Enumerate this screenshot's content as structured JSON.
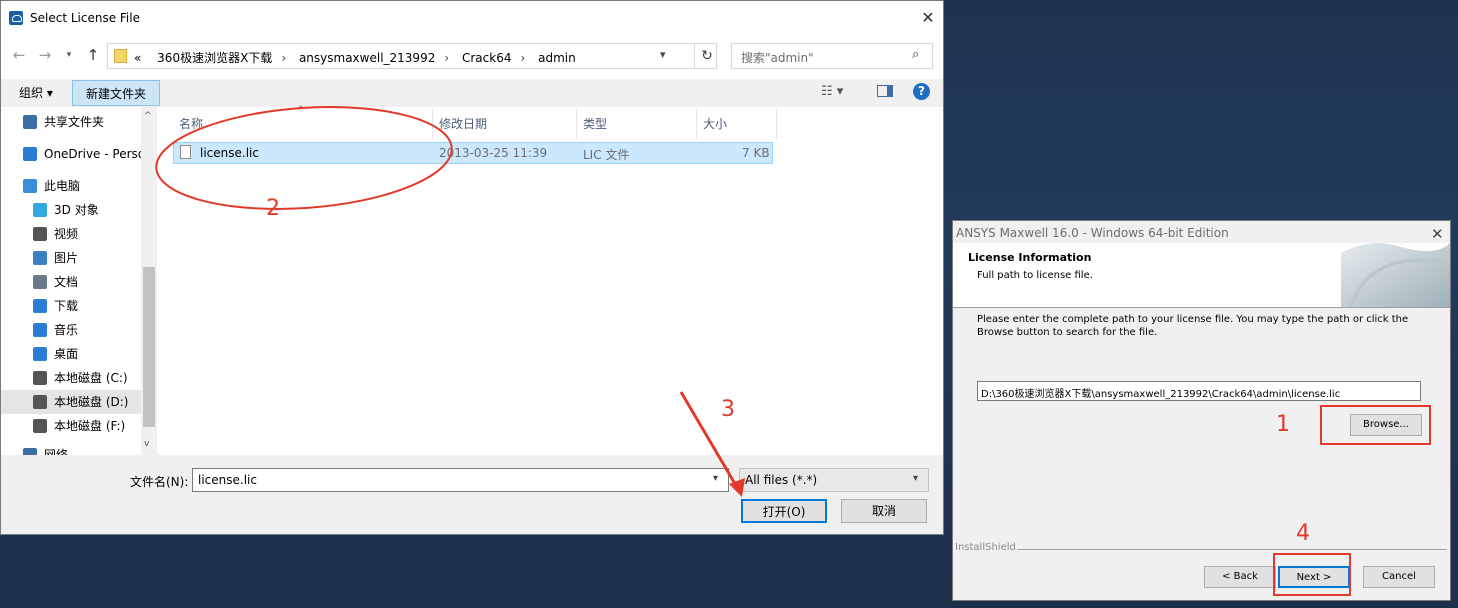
{
  "file_dialog": {
    "title": "Select License File",
    "close": "✕",
    "breadcrumb": {
      "prefix": "«",
      "items": [
        "360极速浏览器X下载",
        "ansysmaxwell_213992",
        "Crack64",
        "admin"
      ],
      "separator": "›"
    },
    "search_placeholder": "搜索\"admin\"",
    "toolbar": {
      "organize": "组织 ▾",
      "new_folder": "新建文件夹"
    },
    "sidebar": [
      {
        "label": "共享文件夹",
        "icon": "network-share-icon",
        "color": "#3c6ea3"
      },
      {
        "label": "OneDrive - Perso",
        "icon": "cloud-icon",
        "color": "#2b7cd3"
      },
      {
        "label": "此电脑",
        "icon": "computer-icon",
        "color": "#3a8ed9"
      },
      {
        "label": "3D 对象",
        "icon": "cube-icon",
        "color": "#31a8e0"
      },
      {
        "label": "视频",
        "icon": "video-icon",
        "color": "#555555"
      },
      {
        "label": "图片",
        "icon": "picture-icon",
        "color": "#3a7fc2"
      },
      {
        "label": "文档",
        "icon": "document-icon",
        "color": "#6b7a8a"
      },
      {
        "label": "下载",
        "icon": "download-icon",
        "color": "#2b7cd3"
      },
      {
        "label": "音乐",
        "icon": "music-icon",
        "color": "#2b7cd3"
      },
      {
        "label": "桌面",
        "icon": "desktop-icon",
        "color": "#2b7cd3"
      },
      {
        "label": "本地磁盘 (C:)",
        "icon": "drive-icon",
        "color": "#555555"
      },
      {
        "label": "本地磁盘 (D:)",
        "icon": "drive-icon",
        "color": "#555555"
      },
      {
        "label": "本地磁盘 (F:)",
        "icon": "drive-icon",
        "color": "#555555"
      },
      {
        "label": "网络",
        "icon": "network-icon",
        "color": "#3c6ea3"
      }
    ],
    "columns": [
      "名称",
      "修改日期",
      "类型",
      "大小"
    ],
    "files": [
      {
        "name": "license.lic",
        "modified": "2013-03-25 11:39",
        "type": "LIC 文件",
        "size": "7 KB"
      }
    ],
    "filename_label": "文件名(N):",
    "filename_value": "license.lic",
    "filter_value": "All files (*.*)",
    "open_button": "打开(O)",
    "cancel_button": "取消"
  },
  "installer": {
    "title": "ANSYS Maxwell 16.0  - Windows 64-bit Edition",
    "close": "✕",
    "heading": "License Information",
    "subheading": "Full path to license file.",
    "description": "Please enter the complete path to your license file. You may type the path or click the Browse button to search for the file.",
    "path_value": "D:\\360极速浏览器X下载\\ansysmaxwell_213992\\Crack64\\admin\\license.lic",
    "browse_button": "Browse...",
    "brand": "InstallShield",
    "back_button": "< Back",
    "next_button": "Next >",
    "cancel_button": "Cancel"
  },
  "annotations": {
    "step1": "1",
    "step2": "2",
    "step3": "3",
    "step4": "4",
    "color": "#e23a2a"
  }
}
